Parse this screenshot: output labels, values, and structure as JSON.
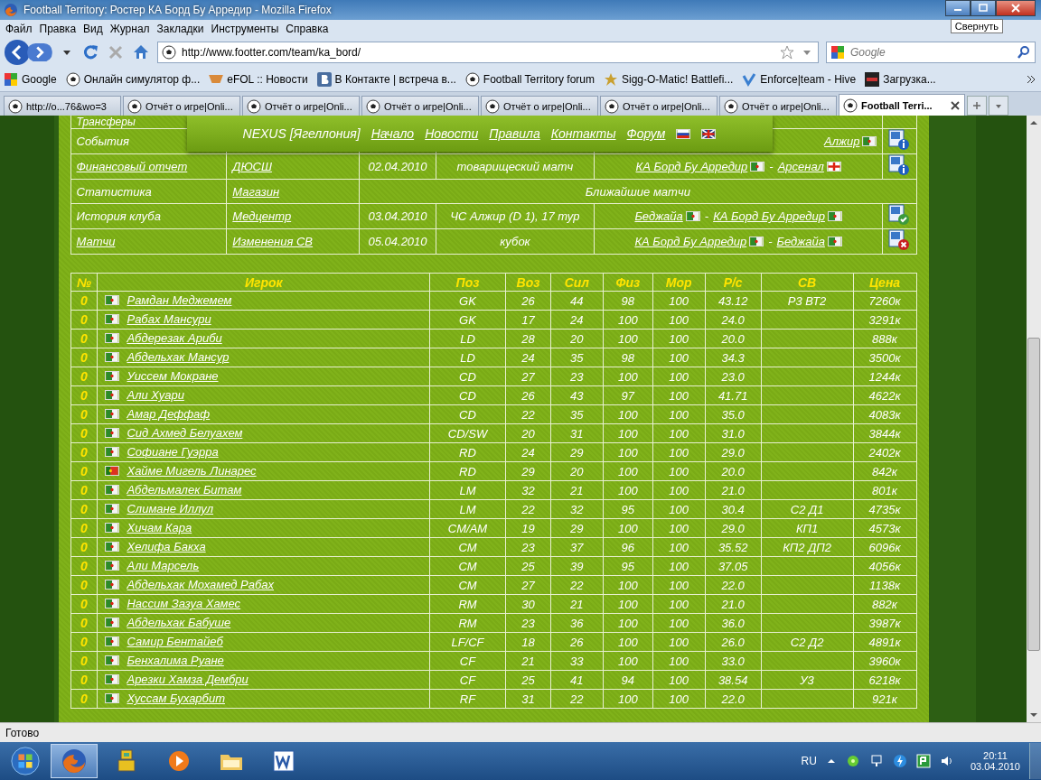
{
  "window": {
    "title": "Football Territory: Ростер КА Борд Бу Арредир - Mozilla Firefox",
    "tooltip": "Свернуть"
  },
  "menu": [
    "Файл",
    "Правка",
    "Вид",
    "Журнал",
    "Закладки",
    "Инструменты",
    "Справка"
  ],
  "address_bar": {
    "value": "http://www.footter.com/team/ka_bord/"
  },
  "search": {
    "placeholder": "Google"
  },
  "bookmarks": [
    {
      "label": "Google",
      "kind": "google"
    },
    {
      "label": "Онлайн симулятор ф...",
      "kind": "ball"
    },
    {
      "label": "eFOL :: Новости",
      "kind": "bowl"
    },
    {
      "label": "В Контакте | встреча в...",
      "kind": "vk"
    },
    {
      "label": "Football Territory forum",
      "kind": "ball"
    },
    {
      "label": "Sigg-O-Matic! Battlefi...",
      "kind": "badge"
    },
    {
      "label": "Enforce|team - Hive",
      "kind": "check"
    },
    {
      "label": "Загрузка...",
      "kind": "bfg"
    }
  ],
  "tabs": [
    {
      "label": "http://o...76&wo=3",
      "selected": false
    },
    {
      "label": "Отчёт о игре|Onli...",
      "selected": false
    },
    {
      "label": "Отчёт о игре|Onli...",
      "selected": false
    },
    {
      "label": "Отчёт о игре|Onli...",
      "selected": false
    },
    {
      "label": "Отчёт о игре|Onli...",
      "selected": false
    },
    {
      "label": "Отчёт о игре|Onli...",
      "selected": false
    },
    {
      "label": "Отчёт о игре|Onli...",
      "selected": false
    },
    {
      "label": "Football Terri...",
      "selected": true
    }
  ],
  "site_menu": {
    "brand": "NEXUS [Ягеллония]",
    "links": [
      "Начало",
      "Новости",
      "Правила",
      "Контакты",
      "Форум"
    ],
    "languages": [
      {
        "kind": "russia"
      },
      {
        "kind": "uk"
      }
    ]
  },
  "club_table": {
    "rows": [
      {
        "label": "Трансферы",
        "label_link": false
      },
      {
        "label": "События",
        "label_link": false,
        "match": {
          "away": {
            "name": "Алжир",
            "flag": {
              "kind": "algeria"
            }
          }
        },
        "status": {
          "kind": "info"
        }
      },
      {
        "label": "Финансовый отчет",
        "label_link": true,
        "link": "ДЮСШ",
        "date": "02.04.2010",
        "type": "товарищеский матч",
        "match": {
          "home": {
            "name": "КА Борд Бу Арредир",
            "flag": {
              "kind": "algeria"
            }
          },
          "separator": "-",
          "away": {
            "name": "Арсенал",
            "flag": {
              "kind": "england"
            }
          }
        },
        "status": {
          "kind": "info"
        }
      },
      {
        "label": "Статистика",
        "label_link": false,
        "link": "Магазин",
        "heading": "Ближайшие матчи"
      },
      {
        "label": "История клуба",
        "label_link": false,
        "link": "Медцентр",
        "date": "03.04.2010",
        "type": "ЧС Алжир (D 1), 17 тур",
        "match": {
          "home": {
            "name": "Беджайа",
            "flag": {
              "kind": "algeria"
            }
          },
          "separator": "-",
          "away": {
            "name": "КА Борд Бу Арредир",
            "flag": {
              "kind": "algeria"
            }
          }
        },
        "status": {
          "kind": "check"
        }
      },
      {
        "label": "Матчи",
        "label_link": true,
        "link": "Изменения СВ",
        "date": "05.04.2010",
        "type": "кубок",
        "match": {
          "home": {
            "name": "КА Борд Бу Арредир",
            "flag": {
              "kind": "algeria"
            }
          },
          "separator": "-",
          "away": {
            "name": "Беджайа",
            "flag": {
              "kind": "algeria"
            }
          }
        },
        "status": {
          "kind": "cross"
        }
      }
    ]
  },
  "roster": {
    "columns": [
      "№",
      "Игрок",
      "Поз",
      "Воз",
      "Сил",
      "Физ",
      "Мор",
      "Р/с",
      "СВ",
      "Цена"
    ],
    "rows": [
      {
        "no": "0",
        "flag": {
          "kind": "algeria"
        },
        "name": "Рамдан Меджемем",
        "pos": "GK",
        "age": "26",
        "str": "44",
        "phys": "98",
        "mor": "100",
        "rs": "43.12",
        "sv": "Р3 ВТ2",
        "price": "7260к"
      },
      {
        "no": "0",
        "flag": {
          "kind": "algeria"
        },
        "name": "Рабах Мансури",
        "pos": "GK",
        "age": "17",
        "str": "24",
        "phys": "100",
        "mor": "100",
        "rs": "24.0",
        "price": "3291к"
      },
      {
        "no": "0",
        "flag": {
          "kind": "algeria"
        },
        "name": "Абдерезак Ариби",
        "pos": "LD",
        "age": "28",
        "str": "20",
        "phys": "100",
        "mor": "100",
        "rs": "20.0",
        "price": "888к"
      },
      {
        "no": "0",
        "flag": {
          "kind": "algeria"
        },
        "name": "Абдельхак Мансур",
        "pos": "LD",
        "age": "24",
        "str": "35",
        "phys": "98",
        "mor": "100",
        "rs": "34.3",
        "price": "3500к"
      },
      {
        "no": "0",
        "flag": {
          "kind": "algeria"
        },
        "name": "Уиссем Мокране",
        "pos": "CD",
        "age": "27",
        "str": "23",
        "phys": "100",
        "mor": "100",
        "rs": "23.0",
        "price": "1244к"
      },
      {
        "no": "0",
        "flag": {
          "kind": "algeria"
        },
        "name": "Али Хуари",
        "pos": "CD",
        "age": "26",
        "str": "43",
        "phys": "97",
        "mor": "100",
        "rs": "41.71",
        "price": "4622к"
      },
      {
        "no": "0",
        "flag": {
          "kind": "algeria"
        },
        "name": "Амар Деффаф",
        "pos": "CD",
        "age": "22",
        "str": "35",
        "phys": "100",
        "mor": "100",
        "rs": "35.0",
        "price": "4083к"
      },
      {
        "no": "0",
        "flag": {
          "kind": "algeria"
        },
        "name": "Сид Ахмед Белуахем",
        "pos": "CD/SW",
        "age": "20",
        "str": "31",
        "phys": "100",
        "mor": "100",
        "rs": "31.0",
        "price": "3844к"
      },
      {
        "no": "0",
        "flag": {
          "kind": "algeria"
        },
        "name": "Софиане Гуэрра",
        "pos": "RD",
        "age": "24",
        "str": "29",
        "phys": "100",
        "mor": "100",
        "rs": "29.0",
        "price": "2402к"
      },
      {
        "no": "0",
        "flag": {
          "kind": "portugal"
        },
        "name": "Хайме Мигель Линарес",
        "pos": "RD",
        "age": "29",
        "str": "20",
        "phys": "100",
        "mor": "100",
        "rs": "20.0",
        "price": "842к"
      },
      {
        "no": "0",
        "flag": {
          "kind": "algeria"
        },
        "name": "Абдельмалек Битам",
        "pos": "LM",
        "age": "32",
        "str": "21",
        "phys": "100",
        "mor": "100",
        "rs": "21.0",
        "price": "801к"
      },
      {
        "no": "0",
        "flag": {
          "kind": "algeria"
        },
        "name": "Слимане Иллул",
        "pos": "LM",
        "age": "22",
        "str": "32",
        "phys": "95",
        "mor": "100",
        "rs": "30.4",
        "sv": "С2 Д1",
        "price": "4735к"
      },
      {
        "no": "0",
        "flag": {
          "kind": "algeria"
        },
        "name": "Хичам Кара",
        "pos": "CM/AM",
        "age": "19",
        "str": "29",
        "phys": "100",
        "mor": "100",
        "rs": "29.0",
        "sv": "КП1",
        "price": "4573к"
      },
      {
        "no": "0",
        "flag": {
          "kind": "algeria"
        },
        "name": "Хелифа Бакха",
        "pos": "CM",
        "age": "23",
        "str": "37",
        "phys": "96",
        "mor": "100",
        "rs": "35.52",
        "sv": "КП2 ДП2",
        "price": "6096к"
      },
      {
        "no": "0",
        "flag": {
          "kind": "algeria"
        },
        "name": "Али Марсель",
        "pos": "CM",
        "age": "25",
        "str": "39",
        "phys": "95",
        "mor": "100",
        "rs": "37.05",
        "price": "4056к"
      },
      {
        "no": "0",
        "flag": {
          "kind": "algeria"
        },
        "name": "Абдельхак Мохамед Рабах",
        "pos": "CM",
        "age": "27",
        "str": "22",
        "phys": "100",
        "mor": "100",
        "rs": "22.0",
        "price": "1138к"
      },
      {
        "no": "0",
        "flag": {
          "kind": "algeria"
        },
        "name": "Нассим Зазуа Хамес",
        "pos": "RM",
        "age": "30",
        "str": "21",
        "phys": "100",
        "mor": "100",
        "rs": "21.0",
        "price": "882к"
      },
      {
        "no": "0",
        "flag": {
          "kind": "algeria"
        },
        "name": "Абдельхак Бабуше",
        "pos": "RM",
        "age": "23",
        "str": "36",
        "phys": "100",
        "mor": "100",
        "rs": "36.0",
        "price": "3987к"
      },
      {
        "no": "0",
        "flag": {
          "kind": "algeria"
        },
        "name": "Самир Бентайеб",
        "pos": "LF/CF",
        "age": "18",
        "str": "26",
        "phys": "100",
        "mor": "100",
        "rs": "26.0",
        "sv": "С2 Д2",
        "price": "4891к"
      },
      {
        "no": "0",
        "flag": {
          "kind": "algeria"
        },
        "name": "Бенхалима Руане",
        "pos": "CF",
        "age": "21",
        "str": "33",
        "phys": "100",
        "mor": "100",
        "rs": "33.0",
        "price": "3960к"
      },
      {
        "no": "0",
        "flag": {
          "kind": "algeria"
        },
        "name": "Арезки Хамза Дембри",
        "pos": "CF",
        "age": "25",
        "str": "41",
        "phys": "94",
        "mor": "100",
        "rs": "38.54",
        "sv": "У3",
        "price": "6218к"
      },
      {
        "no": "0",
        "flag": {
          "kind": "algeria"
        },
        "name": "Хуссам Бухарбит",
        "pos": "RF",
        "age": "31",
        "str": "22",
        "phys": "100",
        "mor": "100",
        "rs": "22.0",
        "price": "921к"
      }
    ]
  },
  "status_bar": {
    "text": "Готово"
  },
  "taskbar": {
    "apps": [
      {
        "kind": "firefox",
        "selected": true
      },
      {
        "kind": "robot",
        "selected": false
      },
      {
        "kind": "media",
        "selected": false
      },
      {
        "kind": "folder",
        "selected": false
      },
      {
        "kind": "word",
        "selected": false
      }
    ],
    "language": "RU",
    "time": "20:11",
    "date": "03.04.2010"
  }
}
